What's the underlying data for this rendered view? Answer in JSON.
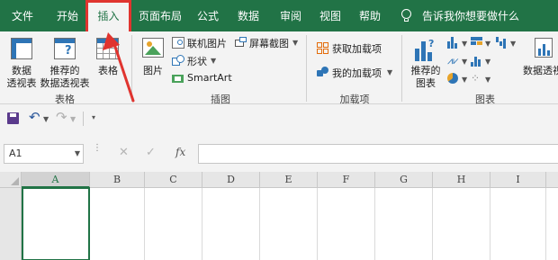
{
  "menu": {
    "tabs": [
      {
        "label": "文件"
      },
      {
        "label": "开始"
      },
      {
        "label": "插入",
        "active": true
      },
      {
        "label": "页面布局"
      },
      {
        "label": "公式"
      },
      {
        "label": "数据"
      },
      {
        "label": "审阅"
      },
      {
        "label": "视图"
      },
      {
        "label": "帮助"
      }
    ],
    "tell_me": "告诉我你想要做什么"
  },
  "ribbon": {
    "tables": {
      "pivot_line1": "数据",
      "pivot_line2": "透视表",
      "recommended_line1": "推荐的",
      "recommended_line2": "数据透视表",
      "table": "表格",
      "group": "表格"
    },
    "illustrations": {
      "pictures": "图片",
      "online_pictures": "联机图片",
      "shapes": "形状",
      "smartart": "SmartArt",
      "screenshot": "屏幕截图",
      "group": "插图"
    },
    "addins": {
      "get_addins": "获取加载项",
      "my_addins": "我的加载项",
      "group": "加载项"
    },
    "charts": {
      "recommended_line1": "推荐的",
      "recommended_line2": "图表",
      "pivot_chart": "数据透视",
      "group": "图表"
    }
  },
  "formula_bar": {
    "name_box": "A1",
    "formula": ""
  },
  "grid": {
    "columns": [
      "A",
      "B",
      "C",
      "D",
      "E",
      "F",
      "G",
      "H",
      "I"
    ],
    "selected_column": "A",
    "active_cell": "A1"
  },
  "colors": {
    "menu_bg": "#217346",
    "highlight": "#e0342f",
    "accent_blue": "#2e75b6"
  }
}
